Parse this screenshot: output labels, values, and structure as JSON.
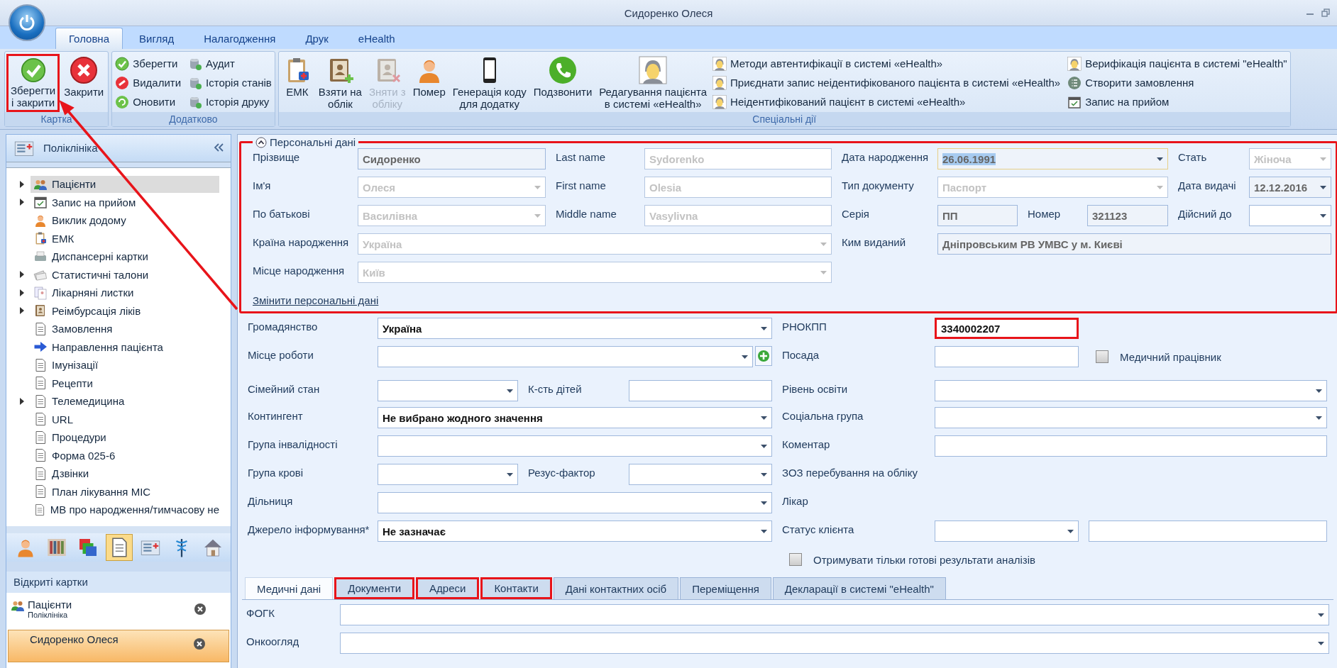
{
  "window": {
    "title": "Сидоренко Олеся"
  },
  "ribbon": {
    "tabs": [
      {
        "label": "Головна",
        "selected": true
      },
      {
        "label": "Вигляд",
        "selected": false
      },
      {
        "label": "Налагодження",
        "selected": false
      },
      {
        "label": "Друк",
        "selected": false
      },
      {
        "label": "eHealth",
        "selected": false
      }
    ],
    "groups": [
      {
        "title": "Картка",
        "buttons": [
          {
            "kind": "large",
            "label": "Зберегти\nі закрити",
            "highlighted": true
          },
          {
            "kind": "large",
            "label": "Закрити",
            "highlighted": false
          }
        ]
      },
      {
        "title": "Додатково",
        "buttons": [
          {
            "kind": "small",
            "label": "Зберегти"
          },
          {
            "kind": "small",
            "label": "Видалити"
          },
          {
            "kind": "small",
            "label": "Оновити"
          },
          {
            "kind": "small",
            "label": "Аудит"
          },
          {
            "kind": "small",
            "label": "Історія станів"
          },
          {
            "kind": "small",
            "label": "Історія друку"
          }
        ]
      },
      {
        "title": "Спеціальні дії",
        "buttons": [
          {
            "kind": "large",
            "label": "ЕМК",
            "disabled": false
          },
          {
            "kind": "large",
            "label": "Взяти на\nоблік",
            "disabled": false
          },
          {
            "kind": "large",
            "label": "Зняти з\nобліку",
            "disabled": true
          },
          {
            "kind": "large",
            "label": "Помер",
            "disabled": false
          },
          {
            "kind": "large",
            "label": "Генерація коду\nдля додатку",
            "disabled": false
          },
          {
            "kind": "large",
            "label": "Подзвонити",
            "disabled": false
          },
          {
            "kind": "large",
            "label": "Редагування пацієнта\nв системі «eHealth»",
            "disabled": false
          },
          {
            "kind": "small",
            "label": "Методи автентифікації в системі «eHealth»",
            "disabled": false
          },
          {
            "kind": "small",
            "label": "Приєднати запис неідентифікованого пацієнта в системі «eHealth»",
            "disabled": false
          },
          {
            "kind": "small",
            "label": "Неідентифікований пацієнт в системі «eHealth»",
            "disabled": false
          },
          {
            "kind": "small",
            "label": "Верифікація пацієнта в системі \"eHealth\"",
            "disabled": false
          },
          {
            "kind": "small",
            "label": "Створити замовлення",
            "disabled": false
          },
          {
            "kind": "small",
            "label": "Запис на прийом",
            "disabled": false
          }
        ]
      }
    ]
  },
  "sidebar": {
    "title": "Поліклініка",
    "items": [
      {
        "label": "Пацієнти",
        "kind": "branch",
        "selected": true
      },
      {
        "label": "Запис на прийом",
        "kind": "branch",
        "selected": false
      },
      {
        "label": "Виклик додому",
        "kind": "leaf",
        "selected": false
      },
      {
        "label": "ЕМК",
        "kind": "leaf",
        "selected": false
      },
      {
        "label": "Диспансерні картки",
        "kind": "leaf",
        "selected": false
      },
      {
        "label": "Статистичні талони",
        "kind": "branch",
        "selected": false
      },
      {
        "label": "Лікарняні листки",
        "kind": "branch",
        "selected": false
      },
      {
        "label": "Реімбурсація ліків",
        "kind": "branch",
        "selected": false
      },
      {
        "label": "Замовлення",
        "kind": "leaf",
        "selected": false
      },
      {
        "label": "Направлення пацієнта",
        "kind": "leaf",
        "selected": false
      },
      {
        "label": "Імунізації",
        "kind": "leaf",
        "selected": false
      },
      {
        "label": "Рецепти",
        "kind": "leaf",
        "selected": false
      },
      {
        "label": "Телемедицина",
        "kind": "branch",
        "selected": false
      },
      {
        "label": "URL",
        "kind": "leaf",
        "selected": false
      },
      {
        "label": "Процедури",
        "kind": "leaf",
        "selected": false
      },
      {
        "label": "Форма 025-6",
        "kind": "leaf",
        "selected": false
      },
      {
        "label": "Дзвінки",
        "kind": "leaf",
        "selected": false
      },
      {
        "label": "План лікування МІС",
        "kind": "leaf",
        "selected": false
      },
      {
        "label": "МВ про народження/тимчасову не",
        "kind": "leaf",
        "selected": false
      }
    ],
    "nav_buttons": [
      {
        "selected": false
      },
      {
        "selected": false
      },
      {
        "selected": false
      },
      {
        "selected": true
      },
      {
        "selected": false
      },
      {
        "selected": false
      },
      {
        "selected": false
      }
    ]
  },
  "open_cards": {
    "title": "Відкриті картки",
    "items": [
      {
        "title": "Пацієнти",
        "subtitle": "Поліклініка",
        "selected": false
      },
      {
        "title": "Сидоренко Олеся",
        "selected": true
      }
    ]
  },
  "personal": {
    "title": "Персональні дані",
    "expanded": true,
    "highlighted": true,
    "fields": [
      {
        "label": "Прізвище",
        "kind": "text",
        "value": "Сидоренко",
        "disabled": false,
        "readonly": true,
        "focused": false
      },
      {
        "label": "Last name",
        "kind": "text",
        "value": "Sydorenko",
        "disabled": true,
        "readonly": false,
        "focused": false
      },
      {
        "label": "Дата народження",
        "kind": "combo",
        "value": "26.06.1991",
        "disabled": false,
        "readonly": true,
        "focused": true
      },
      {
        "label": "Стать",
        "kind": "combo",
        "value": "Жіноча",
        "disabled": true,
        "readonly": false,
        "focused": false
      },
      {
        "label": "Ім'я",
        "kind": "combo",
        "value": "Олеся",
        "disabled": true,
        "readonly": false,
        "focused": false
      },
      {
        "label": "First name",
        "kind": "text",
        "value": "Olesia",
        "disabled": true,
        "readonly": false,
        "focused": false
      },
      {
        "label": "Тип документу",
        "kind": "combo",
        "value": "Паспорт",
        "disabled": true,
        "readonly": false,
        "focused": false
      },
      {
        "label": "Дата видачі",
        "kind": "combo",
        "value": "12.12.2016",
        "disabled": false,
        "readonly": true,
        "focused": false
      },
      {
        "label": "По батькові",
        "kind": "combo",
        "value": "Василівна",
        "disabled": true,
        "readonly": false,
        "focused": false
      },
      {
        "label": "Middle name",
        "kind": "text",
        "value": "Vasylivna",
        "disabled": true,
        "readonly": false,
        "focused": false
      },
      {
        "label": "Серія",
        "kind": "text",
        "value": "ПП",
        "disabled": false,
        "readonly": true,
        "focused": false
      },
      {
        "label": "Номер",
        "kind": "text",
        "value": "321123",
        "disabled": false,
        "readonly": true,
        "focused": false
      },
      {
        "label": "Дійсний до",
        "kind": "combo",
        "disabled": false,
        "readonly": false,
        "focused": false
      },
      {
        "label": "Країна народження",
        "kind": "combo",
        "value": "Україна",
        "disabled": true,
        "readonly": false,
        "focused": false
      },
      {
        "label": "Ким виданий",
        "kind": "text",
        "value": "Дніпровським РВ УМВС  у м. Києві",
        "disabled": false,
        "readonly": true,
        "focused": false
      },
      {
        "label": "Місце народження",
        "kind": "combo",
        "value": "Київ",
        "disabled": true,
        "readonly": false,
        "focused": false
      }
    ],
    "link": "Змінити персональні дані"
  },
  "general": {
    "rows": [
      [
        {
          "label": "Громадянство",
          "kind": "combo",
          "value": "Україна",
          "highlighted": false
        },
        {
          "label": "РНОКПП",
          "kind": "text",
          "value": "3340002207",
          "highlighted": true
        }
      ],
      [
        {
          "label": "Місце роботи",
          "kind": "combo_add",
          "highlighted": false
        },
        {
          "label": "Посада",
          "kind": "text",
          "highlighted": false
        },
        {
          "label": "Медичний працівник",
          "kind": "checkbox",
          "checked": false
        }
      ],
      [
        {
          "label": "Сімейний стан",
          "kind": "combo",
          "highlighted": false
        },
        {
          "label": "К-сть дітей",
          "kind": "text",
          "highlighted": false
        },
        {
          "label": "Рівень освіти",
          "kind": "combo",
          "highlighted": false
        }
      ],
      [
        {
          "label": "Контингент",
          "kind": "combo",
          "value": "Не вибрано жодного значення",
          "highlighted": false
        },
        {
          "label": "Соціальна група",
          "kind": "combo",
          "highlighted": false
        }
      ],
      [
        {
          "label": "Група інвалідності",
          "kind": "combo",
          "highlighted": false
        },
        {
          "label": "Коментар",
          "kind": "text",
          "highlighted": false
        }
      ],
      [
        {
          "label": "Група крові",
          "kind": "combo",
          "highlighted": false
        },
        {
          "label": "Резус-фактор",
          "kind": "combo",
          "highlighted": false
        },
        {
          "label": "ЗОЗ перебування на обліку",
          "kind": "label"
        }
      ],
      [
        {
          "label": "Дільниця",
          "kind": "combo",
          "highlighted": false
        },
        {
          "label": "Лікар",
          "kind": "label"
        }
      ],
      [
        {
          "label": "Джерело інформування*",
          "kind": "combo",
          "value": "Не зазначає",
          "highlighted": false
        },
        {
          "label": "Статус клієнта",
          "kind": "combo",
          "highlighted": false
        },
        {
          "kind": "text",
          "highlighted": false
        }
      ],
      [
        {
          "label": "Отримувати тільки готові результати аналізів",
          "kind": "checkbox",
          "checked": false
        }
      ]
    ]
  },
  "detail_tabs": [
    {
      "label": "Медичні дані",
      "selected": true,
      "highlighted": false
    },
    {
      "label": "Документи",
      "selected": false,
      "highlighted": true
    },
    {
      "label": "Адреси",
      "selected": false,
      "highlighted": true
    },
    {
      "label": "Контакти",
      "selected": false,
      "highlighted": true
    },
    {
      "label": "Дані контактних осіб",
      "selected": false,
      "highlighted": false
    },
    {
      "label": "Переміщення",
      "selected": false,
      "highlighted": false
    },
    {
      "label": "Декларації в системі \"eHealth\"",
      "selected": false,
      "highlighted": false
    }
  ],
  "medical": [
    {
      "label": "ФОГК",
      "kind": "combo"
    },
    {
      "label": "Онкоогляд",
      "kind": "combo"
    }
  ],
  "annotation": {
    "arrow": true
  }
}
